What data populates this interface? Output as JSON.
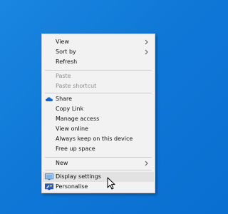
{
  "menu": {
    "view": "View",
    "sort_by": "Sort by",
    "refresh": "Refresh",
    "paste": "Paste",
    "paste_shortcut": "Paste shortcut",
    "share": "Share",
    "copy_link": "Copy Link",
    "manage_access": "Manage access",
    "view_online": "View online",
    "always_keep": "Always keep on this device",
    "free_up_space": "Free up space",
    "new": "New",
    "display_settings": "Display settings",
    "personalise": "Personalise"
  },
  "colors": {
    "desktop_blue": "#0f78d7",
    "menu_bg": "#f2f2f2",
    "hover_bg": "#e2e2e2",
    "disabled_text": "#8c8c8c"
  },
  "icons": {
    "share": "onedrive-cloud-icon",
    "display_settings": "monitor-icon",
    "personalise": "personalise-icon"
  }
}
